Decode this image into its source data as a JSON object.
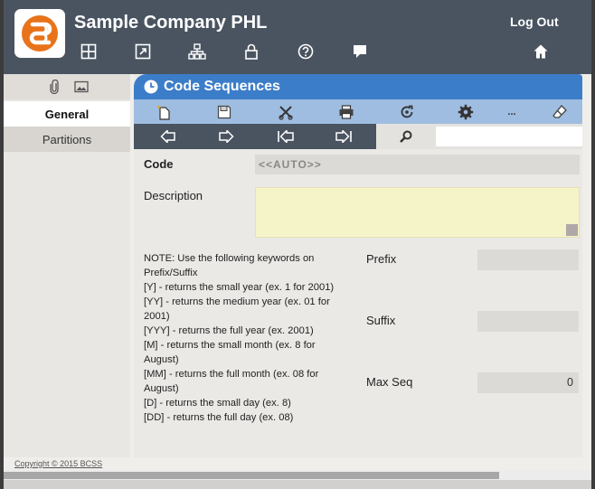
{
  "header": {
    "company_name": "Sample Company PHL",
    "logout_label": "Log Out",
    "icons": [
      "layout-icon",
      "expand-icon",
      "hierarchy-icon",
      "lock-icon",
      "help-icon",
      "chat-icon",
      "home-icon"
    ]
  },
  "sidebar": {
    "icons": [
      "paperclip-icon",
      "image-icon"
    ],
    "tabs": [
      {
        "label": "General",
        "active": true
      },
      {
        "label": "Partitions",
        "active": false
      }
    ]
  },
  "panel": {
    "title": "Code Sequences",
    "toolbar_icons": [
      "new-icon",
      "save-icon",
      "delete-icon",
      "print-icon",
      "refresh-icon",
      "settings-icon",
      "more-icon",
      "eraser-icon"
    ],
    "toolbar_more": "...",
    "nav_icons": [
      "previous-icon",
      "next-icon",
      "first-icon",
      "last-icon"
    ],
    "search": {
      "value": "",
      "placeholder": ""
    }
  },
  "form": {
    "code_label": "Code",
    "code_value": "<<AUTO>>",
    "description_label": "Description",
    "description_value": "",
    "prefix_label": "Prefix",
    "prefix_value": "",
    "suffix_label": "Suffix",
    "suffix_value": "",
    "maxseq_label": "Max Seq",
    "maxseq_value": "0",
    "note_lines": [
      "NOTE: Use the following keywords on",
      "Prefix/Suffix",
      "[Y] - returns the small year (ex. 1 for 2001)",
      "[YY] - returns the medium year (ex. 01 for",
      "2001)",
      "[YYY] - returns the full year (ex. 2001)",
      "[M] - returns the small month (ex. 8 for",
      "August)",
      "[MM] - returns the full month (ex. 08 for",
      "August)",
      "[D] - returns the small day (ex. 8)",
      "[DD] - returns the full day (ex. 08)"
    ]
  },
  "footer": {
    "copyright": "Copyright © 2015 BCSS"
  },
  "colors": {
    "header_bg": "#4a5461",
    "title_bar": "#3c7dc9",
    "toolbar": "#9fbde0",
    "logo_orange": "#e8731a",
    "description_bg": "#f5f3c8"
  }
}
